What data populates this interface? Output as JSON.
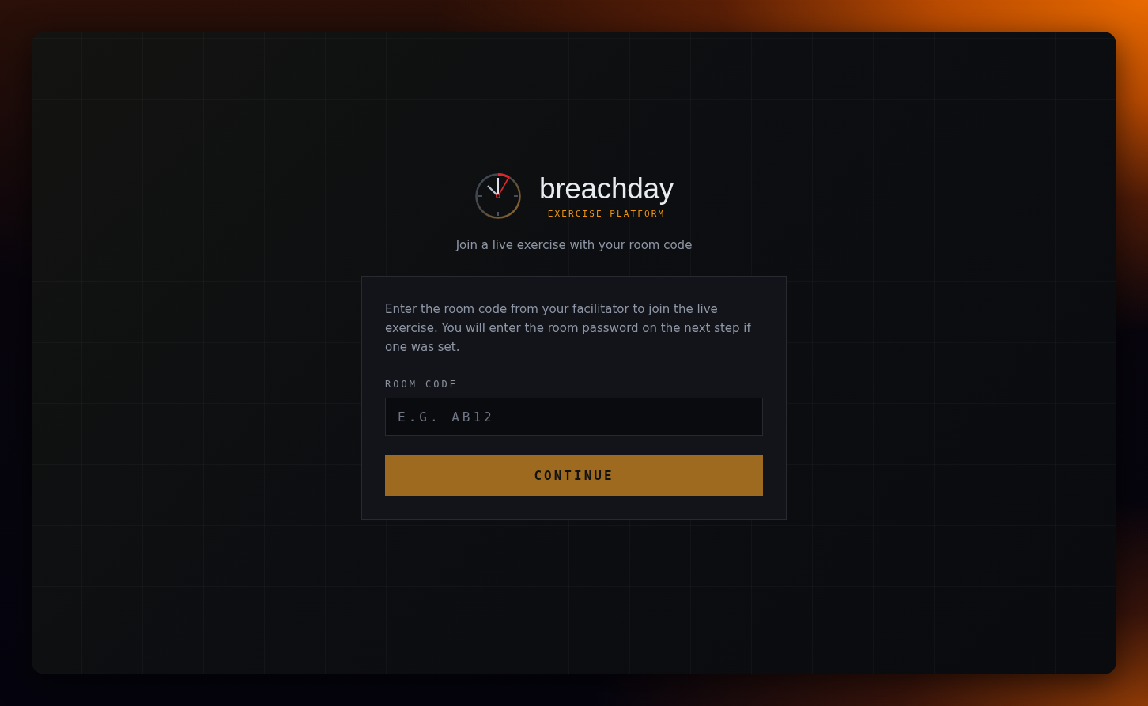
{
  "brand": {
    "name": "breachday",
    "tagline": "EXERCISE PLATFORM"
  },
  "subtitle": "Join a live exercise with your room code",
  "card": {
    "description": "Enter the room code from your facilitator to join the live exercise. You will enter the room password on the next step if one was set.",
    "field": {
      "label": "ROOM CODE",
      "placeholder": "E.G. AB12"
    },
    "button": "CONTINUE"
  }
}
